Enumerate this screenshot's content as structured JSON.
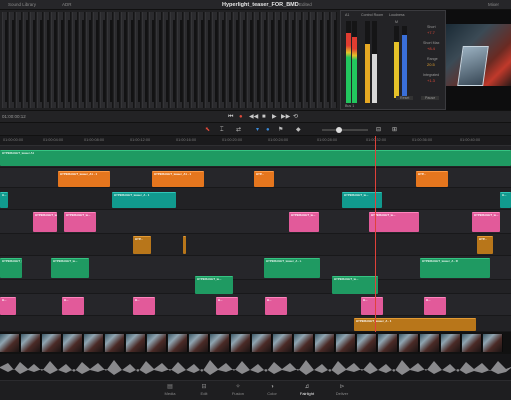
{
  "topbar": {
    "sound_library": "Sound Library",
    "adr": "ADR",
    "project_title": "Hyperlight_teaser_FOR_BMD",
    "project_status": "Edited",
    "mixer": "Mixer"
  },
  "meters": {
    "a1_label": "A1",
    "bus_label": "Control Room",
    "loudness_label": "Loudness",
    "m_label": "M",
    "short_label": "Short",
    "short_value": "+7.7",
    "short_max_label": "Short Max",
    "short_max_value": "+8.4",
    "range_label": "Range",
    "range_value": "20.5",
    "integrated_label": "Integrated",
    "integrated_value": "+1.3",
    "reset_label": "Reset",
    "pause_label": "Pause",
    "bus_mode": "Bus 1",
    "colors": {
      "green": "#22c55e",
      "yellow": "#e6c229",
      "red": "#e03c31",
      "blue": "#3a6fd8"
    }
  },
  "timecode": "01:00:00:12",
  "transport": {
    "rewind_icon": "⏮",
    "back_icon": "◀◀",
    "stop_icon": "■",
    "play_icon": "▶",
    "forward_icon": "▶▶",
    "loop_icon": "⟲",
    "record_icon": "●"
  },
  "ruler": [
    "01:00:00:00",
    "01:00:04:00",
    "01:00:08:00",
    "01:00:12:00",
    "01:00:16:00",
    "01:00:20:00",
    "01:00:24:00",
    "01:00:28:00",
    "01:00:32:00",
    "01:00:36:00",
    "01:00:40:00",
    "01:00:44:00"
  ],
  "clips": {
    "hyper_a1": "HYPERLIGHT_teaser A1",
    "hyper_b": "HYPERLIGHT_te...",
    "hyper_c": "HYPERLIGHT_teaser_A1 - 1",
    "hyper_short": "HYP...",
    "hyper_full": "HYPERLIGHT_teaser_A - 1",
    "hyper_l": "HYPERLIGHT_teaser_A - L",
    "hyper_r": "HYPERLIGHT_teaser_A - R",
    "hyper_tiny": "H...",
    "hyper_ea": "HYPERLIGHT_teaser_A - 1"
  },
  "pages": [
    {
      "icon": "▤",
      "label": "Media"
    },
    {
      "icon": "⊟",
      "label": "Edit"
    },
    {
      "icon": "✧",
      "label": "Fusion"
    },
    {
      "icon": "◑",
      "label": "Color"
    },
    {
      "icon": "♫",
      "label": "Fairlight"
    },
    {
      "icon": "⊳",
      "label": "Deliver"
    }
  ]
}
